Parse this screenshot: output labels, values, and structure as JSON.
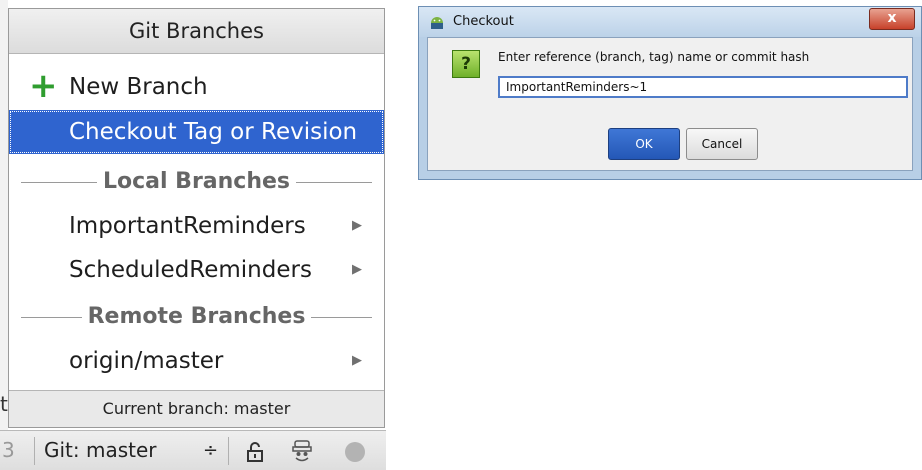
{
  "popup": {
    "title": "Git Branches",
    "new_branch_label": "New Branch",
    "checkout_label": "Checkout Tag or Revision",
    "local_header": "Local Branches",
    "local_branches": [
      "ImportantReminders",
      "ScheduledReminders"
    ],
    "remote_header": "Remote Branches",
    "remote_branches": [
      "origin/master"
    ],
    "footer": "Current branch: master"
  },
  "status_bar": {
    "left_fragment": "3",
    "git_widget": "Git: master",
    "git_widget_arrow": "÷"
  },
  "side_fragment": "t",
  "dialog": {
    "title": "Checkout",
    "close_glyph": "x",
    "question_glyph": "?",
    "prompt": "Enter reference (branch, tag) name or commit hash",
    "input_value": "ImportantReminders~1",
    "ok_label": "OK",
    "cancel_label": "Cancel"
  },
  "colors": {
    "selection": "#2f64cf",
    "plus_green": "#2f9d2f",
    "ok_button": "#2457b6"
  }
}
